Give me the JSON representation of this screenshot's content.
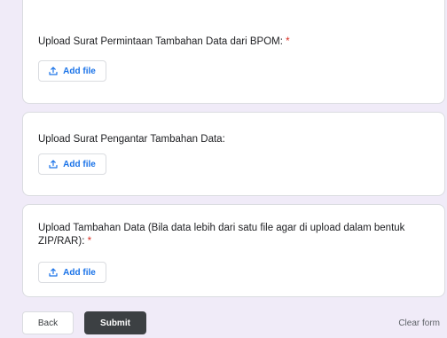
{
  "questions": [
    {
      "label": "Upload Surat Permintaan Tambahan Data dari BPOM:",
      "required_mark": "*",
      "button_label": "Add file"
    },
    {
      "label": "Upload Surat Pengantar Tambahan Data:",
      "required_mark": "",
      "button_label": "Add file"
    },
    {
      "label": "Upload Tambahan Data (Bila data lebih dari satu file agar di upload dalam bentuk ZIP/RAR):",
      "required_mark": "*",
      "button_label": "Add file"
    }
  ],
  "footer": {
    "back_label": "Back",
    "submit_label": "Submit",
    "clear_label": "Clear form"
  },
  "colors": {
    "background": "#f0ebf8",
    "accent": "#1a73e8",
    "required": "#d93025",
    "submit": "#3c4043"
  },
  "icons": {
    "upload": "upload-icon"
  }
}
